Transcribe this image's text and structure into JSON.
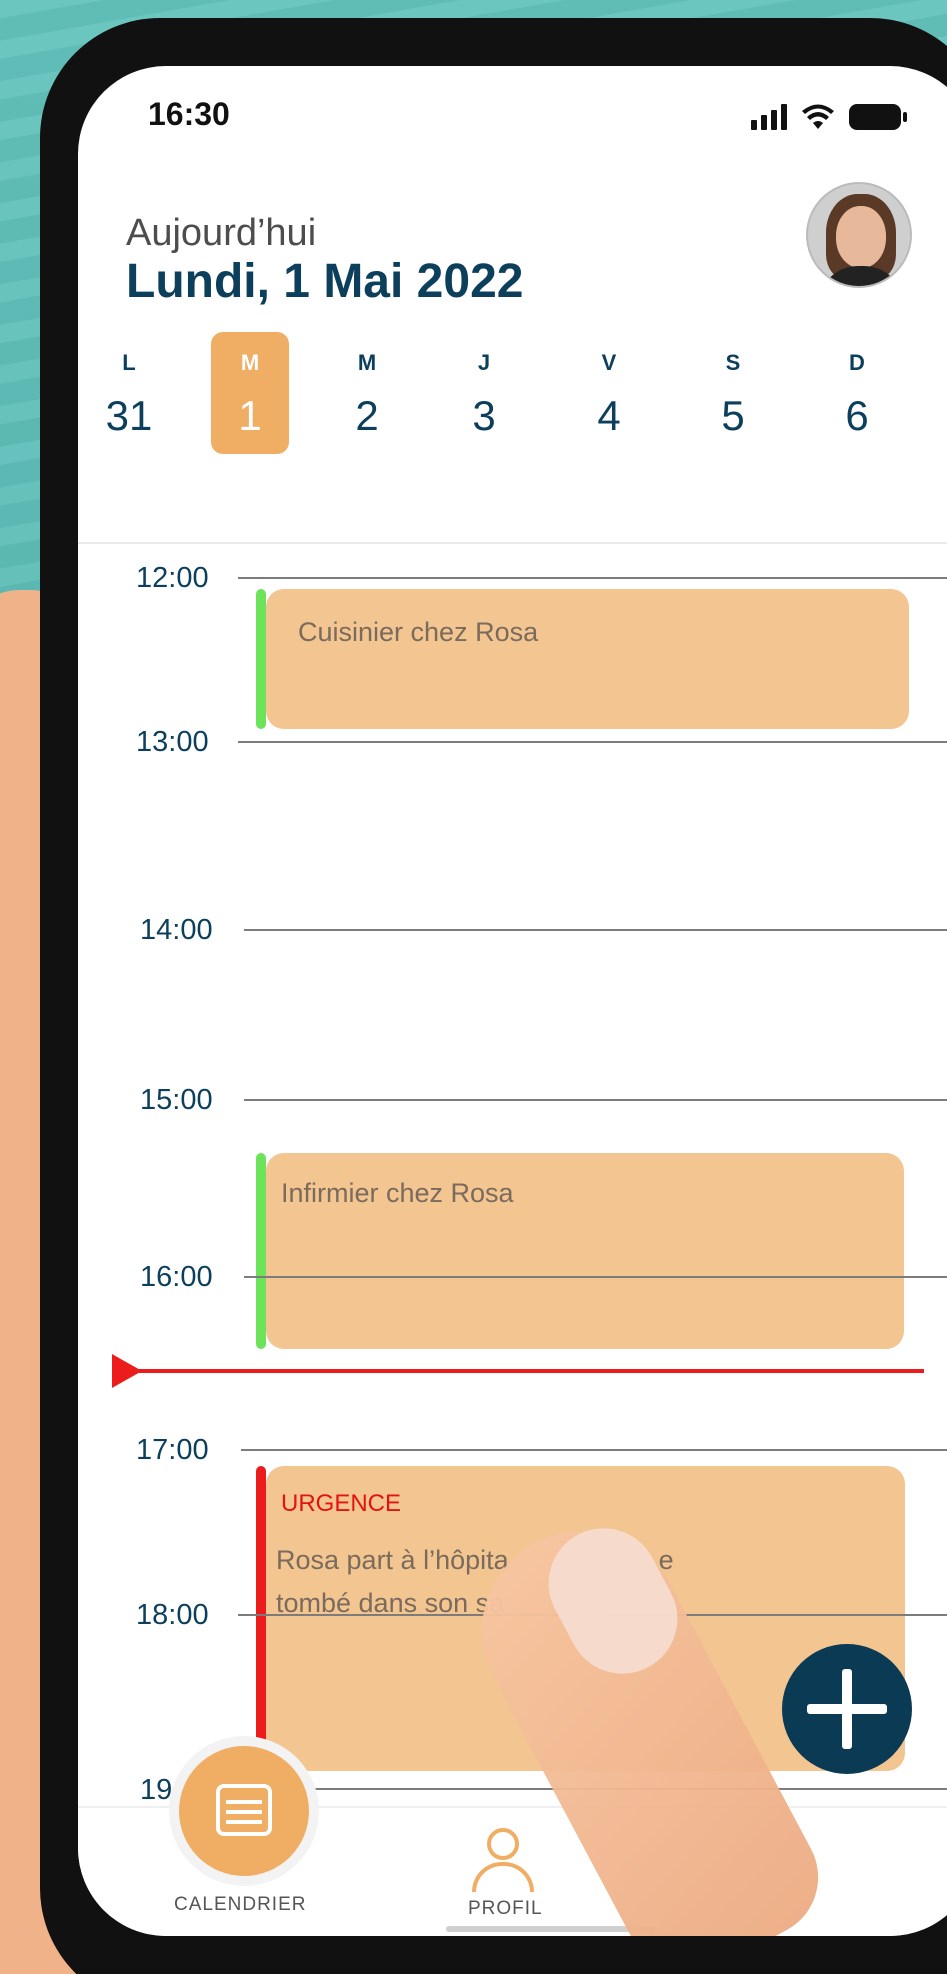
{
  "status_bar": {
    "time": "16:30"
  },
  "header": {
    "subtitle": "Aujourd’hui",
    "title": "Lundi, 1 Mai 2022"
  },
  "week": [
    {
      "letter": "L",
      "num": "31",
      "selected": false
    },
    {
      "letter": "M",
      "num": "1",
      "selected": true
    },
    {
      "letter": "M",
      "num": "2",
      "selected": false
    },
    {
      "letter": "J",
      "num": "3",
      "selected": false
    },
    {
      "letter": "V",
      "num": "4",
      "selected": false
    },
    {
      "letter": "S",
      "num": "5",
      "selected": false
    },
    {
      "letter": "D",
      "num": "6",
      "selected": false
    }
  ],
  "timeline": {
    "hours": [
      "12:00",
      "13:00",
      "14:00",
      "15:00",
      "16:00",
      "17:00",
      "18:00",
      "19:"
    ],
    "events": [
      {
        "title": "Cuisinier chez Rosa",
        "bar_color": "#6de35a"
      },
      {
        "title": "Infirmier chez Rosa",
        "bar_color": "#6de35a"
      },
      {
        "tag": "URGENCE",
        "line1": "Rosa part à l’hôpita",
        "line1_end": "e",
        "line2": "tombé dans son sa",
        "bar_color": "#ec1c1c"
      }
    ],
    "now_line_color": "#ec1c1c"
  },
  "bottom_nav": {
    "calendar_label": "CALENDRIER",
    "profile_label": "PROFIL"
  },
  "colors": {
    "accent": "#efae64",
    "primary": "#0c3f5c",
    "event_bg": "#f2c591"
  }
}
